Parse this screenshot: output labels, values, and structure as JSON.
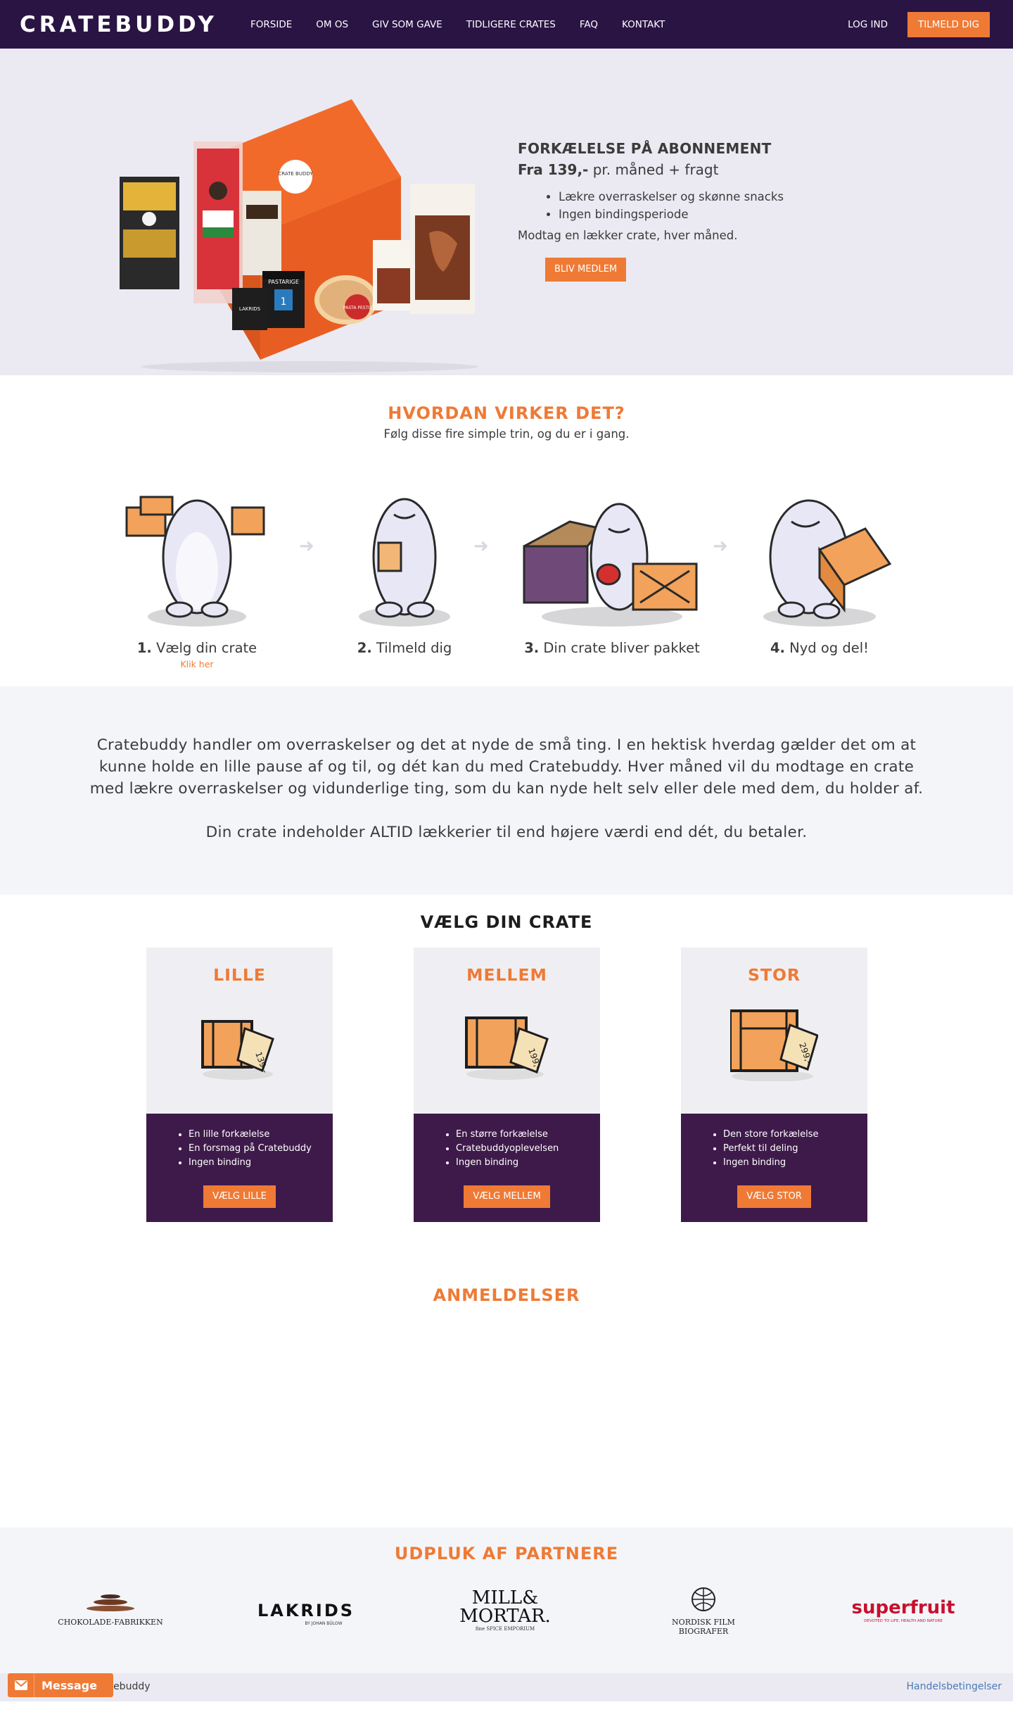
{
  "nav": {
    "logo": "CRATEBUDDY",
    "links": [
      "FORSIDE",
      "OM OS",
      "GIV SOM GAVE",
      "TIDLIGERE CRATES",
      "FAQ",
      "KONTAKT"
    ],
    "login": "LOG IND",
    "signup": "TILMELD DIG"
  },
  "hero": {
    "title": "FORKÆLELSE PÅ ABONNEMENT",
    "price_bold": "Fra 139,-",
    "price_rest": " pr. måned + fragt",
    "bullets": [
      "Lækre overraskelser og skønne snacks",
      "Ingen bindingsperiode"
    ],
    "description": "Modtag en lækker crate, hver måned.",
    "cta": "BLIV MEDLEM",
    "product_texts": [
      "CRATE BUDDY",
      "PASTARIGE",
      "LAKRIDS",
      "1",
      "PASTA PESTO"
    ]
  },
  "how": {
    "title": "HVORDAN VIRKER DET?",
    "subtitle": "Følg disse fire simple trin, og du er i gang.",
    "steps": [
      {
        "num": "1.",
        "label": " Vælg din crate",
        "link": "Klik her"
      },
      {
        "num": "2.",
        "label": " Tilmeld dig"
      },
      {
        "num": "3.",
        "label": " Din crate bliver pakket"
      },
      {
        "num": "4.",
        "label": " Nyd og del!"
      }
    ]
  },
  "about": {
    "paragraph1": "Cratebuddy handler om overraskelser og det at nyde de små ting. I en hektisk hverdag gælder det om at kunne holde en lille pause af og til, og dét kan du med Cratebuddy. Hver måned vil du modtage en crate med lækre overraskelser og vidunderlige ting, som du kan nyde helt selv eller dele med dem, du holder af.",
    "paragraph2": "Din crate indeholder ALTID lækkerier til end højere værdi end dét, du betaler."
  },
  "crates": {
    "title": "VÆLG DIN CRATE",
    "cards": [
      {
        "name": "LILLE",
        "price_tag": "139,-",
        "bullets": [
          "En lille forkælelse",
          "En forsmag på Cratebuddy",
          "Ingen binding"
        ],
        "cta": "VÆLG LILLE"
      },
      {
        "name": "MELLEM",
        "price_tag": "199,-",
        "bullets": [
          "En større forkælelse",
          "Cratebuddyoplevelsen",
          "Ingen binding"
        ],
        "cta": "VÆLG MELLEM"
      },
      {
        "name": "STOR",
        "price_tag": "299,-",
        "bullets": [
          "Den store forkælelse",
          "Perfekt til deling",
          "Ingen binding"
        ],
        "cta": "VÆLG STOR"
      }
    ]
  },
  "reviews": {
    "title": "ANMELDELSER"
  },
  "partners": {
    "title": "UDPLUK AF PARTNERE",
    "logos": [
      {
        "name": "CHOKOLADE-FABRIKKEN"
      },
      {
        "name": "LAKRIDS",
        "sub": "BY JOHAN BÜLOW"
      },
      {
        "name": "MILL & MORTAR",
        "line1": "MILL&",
        "line2": "MORTAR.",
        "sub": "fine SPICE EMPORIUM"
      },
      {
        "name": "NORDISK FILM BIOGRAFER",
        "line1": "NORDISK FILM",
        "line2": "BIOGRAFER"
      },
      {
        "name": "superfruit",
        "sub": "DEVOTED TO LIFE, HEALTH AND NATURE"
      }
    ]
  },
  "footer": {
    "brand": "atebuddy",
    "terms": "Handelsbetingelser",
    "message": "Message"
  },
  "colors": {
    "nav_bg": "#2a1444",
    "accent": "#ef7a35",
    "card_purple": "#3e1a4a",
    "hero_bg": "#ebeaf2"
  }
}
